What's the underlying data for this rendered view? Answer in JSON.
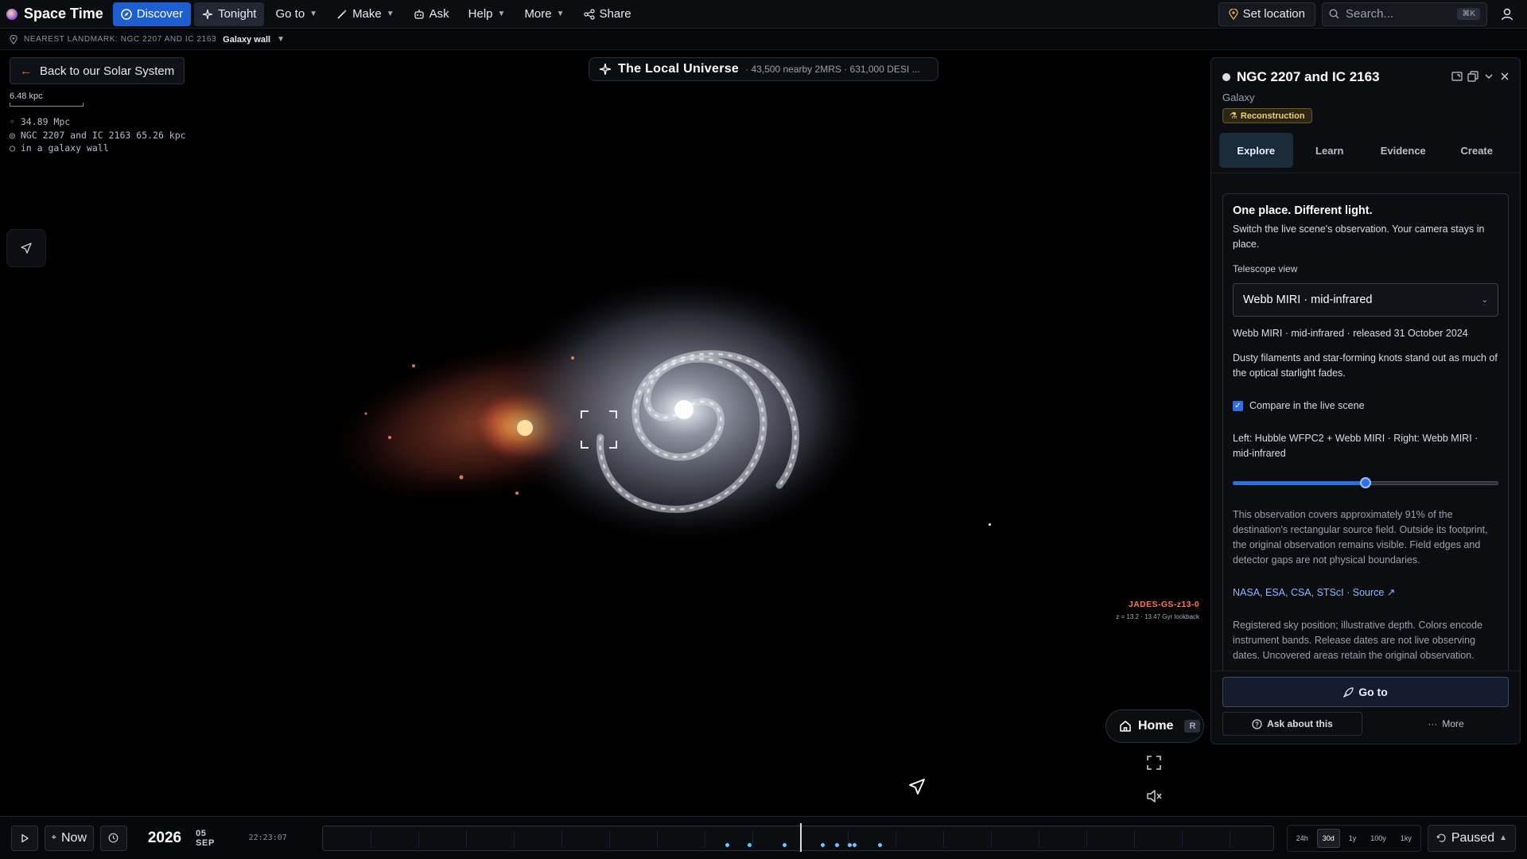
{
  "app": {
    "title": "Space Time",
    "nav": [
      {
        "label": "Discover",
        "icon": "compass-icon"
      },
      {
        "label": "Tonight",
        "icon": "sparkle-icon"
      },
      {
        "label": "Go to",
        "icon": ""
      },
      {
        "label": "Make",
        "icon": "wand-icon"
      },
      {
        "label": "Ask",
        "icon": "robot-icon"
      },
      {
        "label": "Help",
        "icon": ""
      },
      {
        "label": "More",
        "icon": ""
      },
      {
        "label": "Share",
        "icon": "share-icon"
      }
    ],
    "set_location": "Set location",
    "search_placeholder": "Search...",
    "search_shortcut": "⌘K"
  },
  "landmark": {
    "label": "NEAREST LANDMARK: NGC 2207 AND IC 2163",
    "tag": "Galaxy wall"
  },
  "viewport": {
    "back_label": "Back to our Solar System",
    "scale_label": "6.48 kpc",
    "distances": [
      "34.89 Mpc",
      "NGC 2207 and IC 2163 65.26 kpc",
      "in a galaxy wall"
    ],
    "banner_title": "The Local Universe",
    "banner_subtitle": "· 43,500 nearby 2MRS · 631,000 DESI ...",
    "jades_name": "JADES-GS-z13-0",
    "jades_info": "z = 13.2 · 13.47 Gyr lookback",
    "home_label": "Home",
    "home_key": "R"
  },
  "panel": {
    "title": "NGC 2207 and IC 2163",
    "subtitle": "Galaxy",
    "badge": "Reconstruction",
    "tabs": [
      "Explore",
      "Learn",
      "Evidence",
      "Create"
    ],
    "active_tab": "Explore",
    "card": {
      "heading": "One place. Different light.",
      "intro": "Switch the live scene's observation. Your camera stays in place.",
      "telescope_label": "Telescope view",
      "telescope_value": "Webb MIRI · mid-infrared",
      "release": "Webb MIRI · mid-infrared · released 31 October 2024",
      "description": "Dusty filaments and star-forming knots stand out as much of the optical starlight fades.",
      "compare_label": "Compare in the live scene",
      "compare_checked": true,
      "compare_detail": "Left: Hubble WFPC2 + Webb MIRI · Right: Webb MIRI · mid-infrared",
      "slider_value": 0.5,
      "coverage": "This observation covers approximately 91% of the destination's rectangular source field. Outside its footprint, the original observation remains visible. Field edges and detector gaps are not physical boundaries.",
      "credit": "NASA, ESA, CSA, STScI · Source ↗",
      "note": "Registered sky position; illustrative depth. Colors encode instrument bands. Release dates are not live observing dates. Uncovered areas retain the original observation."
    },
    "goto_label": "Go to",
    "ask_label": "Ask about this",
    "more_label": "More"
  },
  "timeline": {
    "now_label": "Now",
    "year": "2026",
    "date": "05 SEP",
    "time": "22:23:07",
    "zooms": [
      "24h",
      "30d",
      "1y",
      "100y",
      "1ky"
    ],
    "active_zoom": "30d",
    "state": "Paused"
  },
  "colors": {
    "accent": "#1d5fd1",
    "badge": "#f0d070",
    "event": "#6fc4ff",
    "jades": "#ff7a4a"
  }
}
